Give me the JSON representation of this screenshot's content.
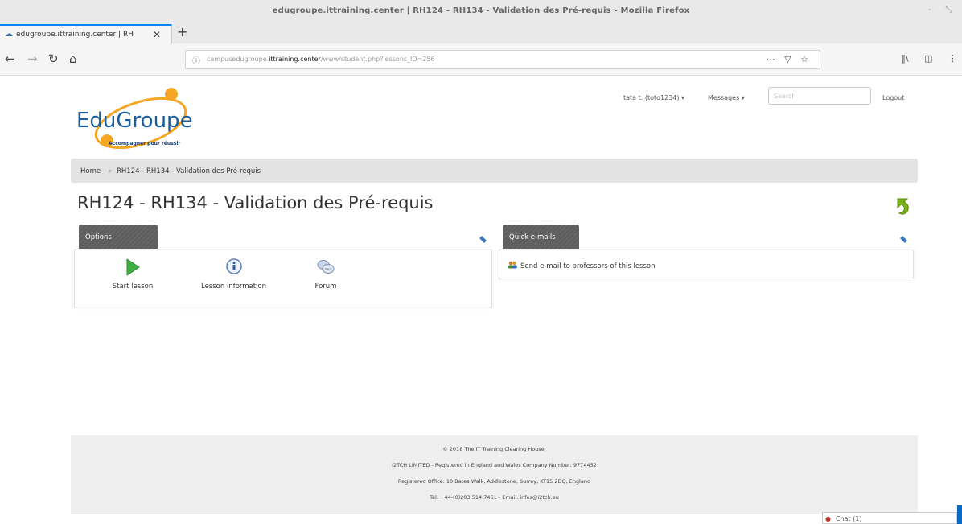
{
  "window": {
    "title": "edugroupe.ittraining.center | RH124 - RH134 - Validation des Pré-requis - Mozilla Firefox",
    "controls": [
      "-",
      "⤡"
    ]
  },
  "browser": {
    "tab_title": "edugroupe.ittraining.center | RH",
    "tab_close": "✕",
    "new_tab": "+",
    "back": "←",
    "forward": "→",
    "reload": "↻",
    "home": "⌂",
    "url_prefix": "campusedugroupe.",
    "url_domain": "ittraining.center",
    "url_path": "/www/student.php?lessons_ID=256",
    "url_icons": [
      "⋯",
      "▽",
      "☆"
    ],
    "right_icons": [
      "‖\\",
      "◫",
      "⋮"
    ]
  },
  "site": {
    "logo_name": "EduGroupe",
    "logo_tagline": "Accompagner pour réussir",
    "user": "tata t. (toto1234) ▾",
    "messages": "Messages ▾",
    "search_placeholder": "Search",
    "logout": "Logout"
  },
  "breadcrumb": {
    "home": "Home",
    "sep": "»",
    "current": "RH124 - RH134 - Validation des Pré-requis"
  },
  "page_title": "RH124 - RH134 - Validation des Pré-requis",
  "options": {
    "tab_label": "Options",
    "items": [
      {
        "label": "Start lesson",
        "icon": "play-icon"
      },
      {
        "label": "Lesson information",
        "icon": "info-icon"
      },
      {
        "label": "Forum",
        "icon": "forum-icon"
      }
    ]
  },
  "quick_emails": {
    "tab_label": "Quick e-mails",
    "link": "Send e-mail to professors of this lesson"
  },
  "footer": {
    "lines": [
      "© 2018 The IT Training Clearing House,",
      "I2TCH LIMITED - Registered in England and Wales Company Number: 9774452",
      "Registered Office: 10 Bates Walk, Addlestone, Surrey, KT15 2DQ, England",
      "Tel. +44-(0)203 514 7461 - Email. infos@i2tch.eu"
    ]
  },
  "chat": {
    "label": "Chat (1)"
  },
  "colors": {
    "brand_blue": "#1a5d9a",
    "brand_orange": "#f5a623",
    "tab_dark": "#5d5d5d",
    "play_green": "#3cb043",
    "back_arrow": "#7ab317"
  }
}
